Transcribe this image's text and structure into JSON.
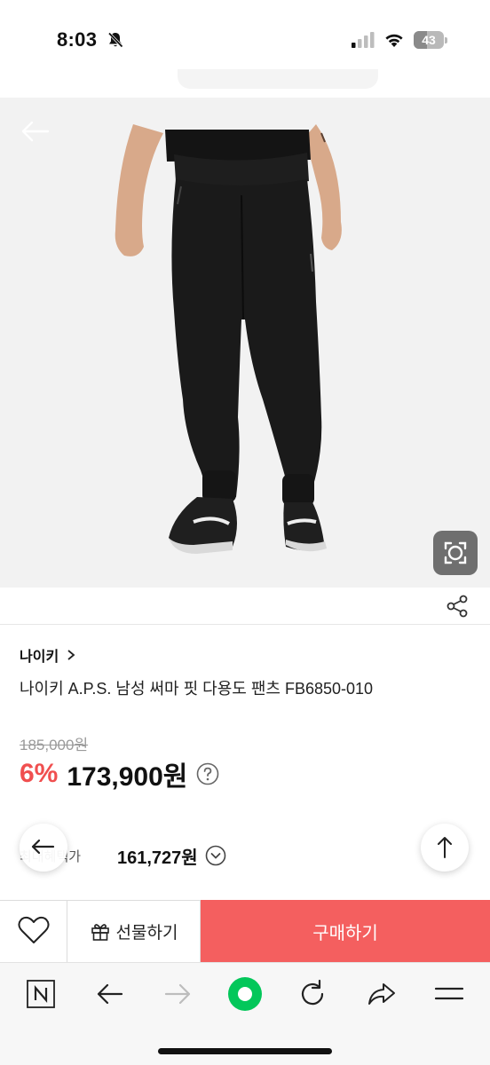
{
  "status_bar": {
    "time": "8:03",
    "battery": "43",
    "battery_level": 0.43
  },
  "product": {
    "brand": "나이키",
    "title": "나이키 A.P.S. 남성 써마 핏 다용도 팬츠 FB6850-010",
    "original_price": "185,000원",
    "discount": "6%",
    "price": "173,900원",
    "benefit_label": "최대혜택가",
    "benefit_price": "161,727원",
    "image_description_icon": "product-photo"
  },
  "purchase_bar": {
    "gift_label": "선물하기",
    "buy_label": "구매하기"
  },
  "colors": {
    "accent_red": "#f04f4f",
    "buy_button": "#f45f5f",
    "naver_green": "#03c75a"
  },
  "icons": {
    "back": "arrow-left-icon",
    "lens": "camera-lens-icon",
    "share": "share-icon",
    "wishlist": "heart-icon",
    "gift": "gift-icon",
    "scroll_top": "arrow-up-icon",
    "toolbar": [
      "naver-n-icon",
      "back-icon",
      "forward-icon",
      "green-dot-icon",
      "reload-icon",
      "share-arrow-icon",
      "menu-icon"
    ]
  }
}
